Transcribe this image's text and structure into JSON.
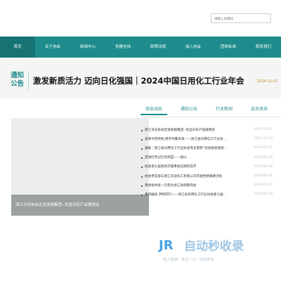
{
  "search": {
    "placeholder": "请输入关键词"
  },
  "nav": {
    "items": [
      "首页",
      "关于协会",
      "新闻中心",
      "党建在线",
      "政策法规",
      "加入协会",
      "团体标准",
      "联系我们"
    ]
  },
  "notice": {
    "badge_line1": "通知",
    "badge_line2": "公告",
    "headline": "激发新质活力 迈向日化强国｜2024中国日用化工行业年会",
    "date": "2024-12-01"
  },
  "tabs": [
    "协会动态",
    "通知公告",
    "行业新闻",
    "会员风采"
  ],
  "photo": {
    "caption": "浙江日化协会走进浙报集团--优选日化产品展销会"
  },
  "news": [
    {
      "title": "浙江日化协会走进浙报集团--优选日化产品展销会",
      "date": "2024-12-27"
    },
    {
      "title": "奋革中求新机 携手共赢未来——浙江省日用化工行业协...",
      "date": "2024-12-23"
    },
    {
      "title": "喜报｜浙江省日用化工行业协会党支部获“先进基层党组...",
      "date": "2024-07-01"
    },
    {
      "title": "走进红色记忆的摇篮——船山",
      "date": "2024-06-28"
    },
    {
      "title": "协会第七届第四次理事会议顺利召开",
      "date": "2024-06-28"
    },
    {
      "title": "协会党支部与浙江华迪化工有限公司开展党建联建活动",
      "date": "2024-06-21"
    },
    {
      "title": "我会秘书处一行走访浙江省储建商会",
      "date": "2024-05-17"
    },
    {
      "title": "乘风破浪 梦想同行——浙江省日用化工行业协会第七届...",
      "date": "2024-01-20"
    }
  ],
  "watermark": {
    "logo": "JR",
    "title": "自动秒收录",
    "tagline": "做上链接一来访一次一自动收录"
  },
  "colors": {
    "primary": "#1e8c8c",
    "date_accent": "#c98a2a"
  }
}
